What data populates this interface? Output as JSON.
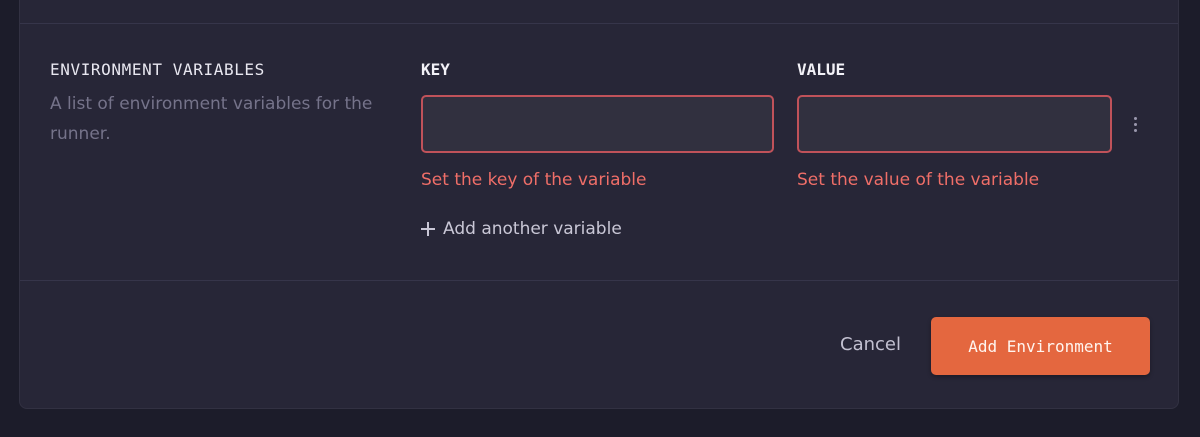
{
  "section": {
    "title": "ENVIRONMENT VARIABLES",
    "description": "A list of environment variables for the runner."
  },
  "variables": {
    "key_label": "KEY",
    "value_label": "VALUE",
    "rows": [
      {
        "key": "",
        "value": "",
        "key_error": "Set the key of the variable",
        "value_error": "Set the value of the variable"
      }
    ],
    "add_label": "Add another variable"
  },
  "footer": {
    "cancel_label": "Cancel",
    "submit_label": "Add Environment"
  },
  "colors": {
    "background": "#1c1c2a",
    "card": "#272637",
    "error": "#ef6e68",
    "input_border_error": "#c0525a",
    "accent": "#e4673f"
  },
  "icons": {
    "add": "plus-icon",
    "row_menu": "more-vertical-icon"
  }
}
